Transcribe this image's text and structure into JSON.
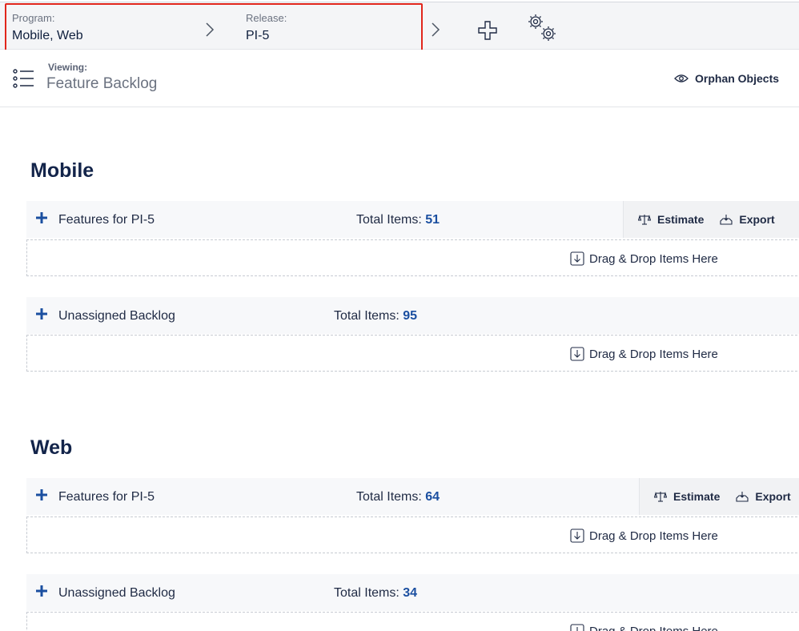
{
  "context_bar": {
    "program_label": "Program:",
    "program_value": "Mobile, Web",
    "release_label": "Release:",
    "release_value": "PI-5",
    "add_icon": "plus-icon",
    "settings_icon": "gears-icon"
  },
  "view_header": {
    "viewing_label": "Viewing:",
    "viewing_value": "Feature Backlog",
    "orphan_label": "Orphan Objects"
  },
  "sections": [
    {
      "title": "Mobile",
      "groups": [
        {
          "title": "Features for  PI-5",
          "total_label": "Total Items:",
          "total_value": "51",
          "actions": [
            "Estimate",
            "Export"
          ],
          "dropzone": "Drag & Drop Items Here"
        },
        {
          "title": "Unassigned Backlog",
          "total_label": "Total Items:",
          "total_value": "95",
          "dropzone": "Drag & Drop Items Here"
        }
      ]
    },
    {
      "title": "Web",
      "groups": [
        {
          "title": "Features for  PI-5",
          "total_label": "Total Items:",
          "total_value": "64",
          "actions": [
            "Estimate",
            "Export"
          ],
          "dropzone": "Drag & Drop Items Here"
        },
        {
          "title": "Unassigned Backlog",
          "total_label": "Total Items:",
          "total_value": "34",
          "dropzone": "Drag & Drop Items Here"
        }
      ]
    }
  ],
  "colors": {
    "accent": "#1b4fa0",
    "highlight_border": "#e1261c",
    "heading": "#13244a"
  }
}
